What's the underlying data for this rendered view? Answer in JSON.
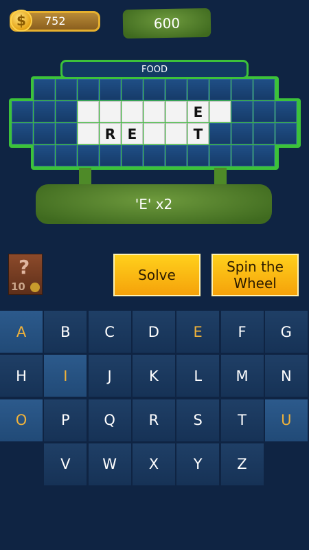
{
  "coins": {
    "value": "752",
    "icon": "coin-icon",
    "symbol": "$"
  },
  "score": "600",
  "category": "FOOD",
  "board": {
    "rows": [
      [
        "",
        "",
        "",
        "",
        "",
        "",
        "",
        "",
        "",
        "",
        "",
        ""
      ],
      [
        "",
        "",
        "",
        "",
        "",
        "",
        "",
        "",
        "",
        "",
        "",
        "",
        "",
        "",
        ""
      ],
      [
        "",
        "",
        "",
        "",
        "",
        "",
        "",
        "",
        "",
        "",
        "",
        "",
        "",
        "",
        ""
      ],
      [
        "",
        "",
        "",
        "",
        "",
        "",
        "",
        "",
        "",
        "",
        "",
        ""
      ]
    ],
    "revealed": [
      {
        "row": 1,
        "col": 3,
        "letter": ""
      },
      {
        "row": 1,
        "col": 4,
        "letter": ""
      },
      {
        "row": 1,
        "col": 5,
        "letter": ""
      },
      {
        "row": 1,
        "col": 6,
        "letter": ""
      },
      {
        "row": 1,
        "col": 7,
        "letter": ""
      },
      {
        "row": 1,
        "col": 8,
        "letter": "E"
      },
      {
        "row": 1,
        "col": 9,
        "letter": ""
      },
      {
        "row": 2,
        "col": 3,
        "letter": ""
      },
      {
        "row": 2,
        "col": 4,
        "letter": "R"
      },
      {
        "row": 2,
        "col": 5,
        "letter": "E"
      },
      {
        "row": 2,
        "col": 6,
        "letter": ""
      },
      {
        "row": 2,
        "col": 7,
        "letter": ""
      },
      {
        "row": 2,
        "col": 8,
        "letter": "T"
      }
    ]
  },
  "message": "'E' x2",
  "hint": {
    "icon": "question-mark-icon",
    "symbol": "?",
    "cost": "10"
  },
  "buttons": {
    "solve": "Solve",
    "spin": "Spin the Wheel"
  },
  "keyboard": [
    {
      "letter": "A",
      "state": "vowel-used"
    },
    {
      "letter": "B",
      "state": ""
    },
    {
      "letter": "C",
      "state": ""
    },
    {
      "letter": "D",
      "state": ""
    },
    {
      "letter": "E",
      "state": "used"
    },
    {
      "letter": "F",
      "state": ""
    },
    {
      "letter": "G",
      "state": ""
    },
    {
      "letter": "H",
      "state": ""
    },
    {
      "letter": "I",
      "state": "vowel-used"
    },
    {
      "letter": "J",
      "state": ""
    },
    {
      "letter": "K",
      "state": ""
    },
    {
      "letter": "L",
      "state": ""
    },
    {
      "letter": "M",
      "state": ""
    },
    {
      "letter": "N",
      "state": ""
    },
    {
      "letter": "O",
      "state": "vowel-used"
    },
    {
      "letter": "P",
      "state": ""
    },
    {
      "letter": "Q",
      "state": ""
    },
    {
      "letter": "R",
      "state": ""
    },
    {
      "letter": "S",
      "state": ""
    },
    {
      "letter": "T",
      "state": ""
    },
    {
      "letter": "U",
      "state": "vowel-used"
    },
    {
      "letter": "",
      "state": "blank"
    },
    {
      "letter": "V",
      "state": ""
    },
    {
      "letter": "W",
      "state": ""
    },
    {
      "letter": "X",
      "state": ""
    },
    {
      "letter": "Y",
      "state": ""
    },
    {
      "letter": "Z",
      "state": ""
    },
    {
      "letter": "",
      "state": "blank"
    }
  ]
}
